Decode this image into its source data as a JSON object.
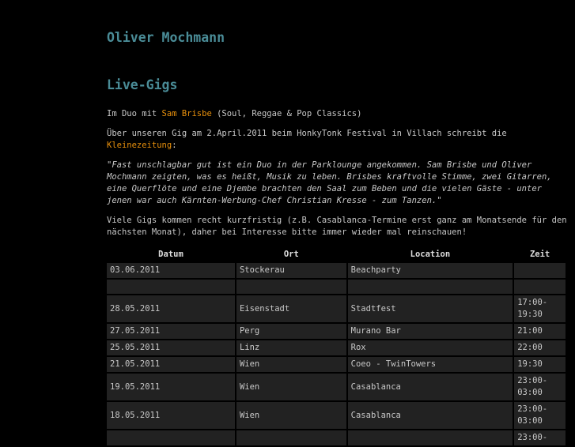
{
  "site_title": "Oliver Mochmann",
  "page_title": "Live-Gigs",
  "intro": {
    "prefix": "Im Duo mit ",
    "link": "Sam Brisbe",
    "suffix": " (Soul, Reggae & Pop Classics)"
  },
  "review": {
    "text": "Über unseren Gig am 2.April.2011 beim HonkyTonk Festival in Villach schreibt die ",
    "link": "Kleinezeitung",
    "suffix": ":"
  },
  "quote": "\"Fast unschlagbar gut ist ein Duo in der Parklounge angekommen. Sam Brisbe und Oliver Mochmann zeigten, was es heißt, Musik zu leben. Brisbes kraftvolle Stimme, zwei Gitarren, eine Querflöte und eine Djembe brachten den Saal zum Beben und die vielen Gäste - unter jenen war auch Kärnten-Werbung-Chef Christian Kresse - zum Tanzen.\"",
  "note": "Viele Gigs kommen recht kurzfristig (z.B. Casablanca-Termine erst ganz am Monatsende für den nächsten Monat), daher bei Interesse bitte immer wieder mal reinschauen!",
  "table": {
    "headers": [
      "Datum",
      "Ort",
      "Location",
      "Zeit"
    ],
    "rows": [
      [
        "03.06.2011",
        "Stockerau",
        "Beachparty",
        ""
      ],
      [
        "",
        "",
        "",
        ""
      ],
      [
        "28.05.2011",
        "Eisenstadt",
        "Stadtfest",
        "17:00-19:30"
      ],
      [
        "27.05.2011",
        "Perg",
        "Murano Bar",
        "21:00"
      ],
      [
        "25.05.2011",
        "Linz",
        "Rox",
        "22:00"
      ],
      [
        "21.05.2011",
        "Wien",
        "Coeo - TwinTowers",
        "19:30"
      ],
      [
        "19.05.2011",
        "Wien",
        "Casablanca",
        "23:00-03:00"
      ],
      [
        "18.05.2011",
        "Wien",
        "Casablanca",
        "23:00-03:00"
      ],
      [
        "",
        "",
        "",
        "23:00-"
      ]
    ]
  }
}
